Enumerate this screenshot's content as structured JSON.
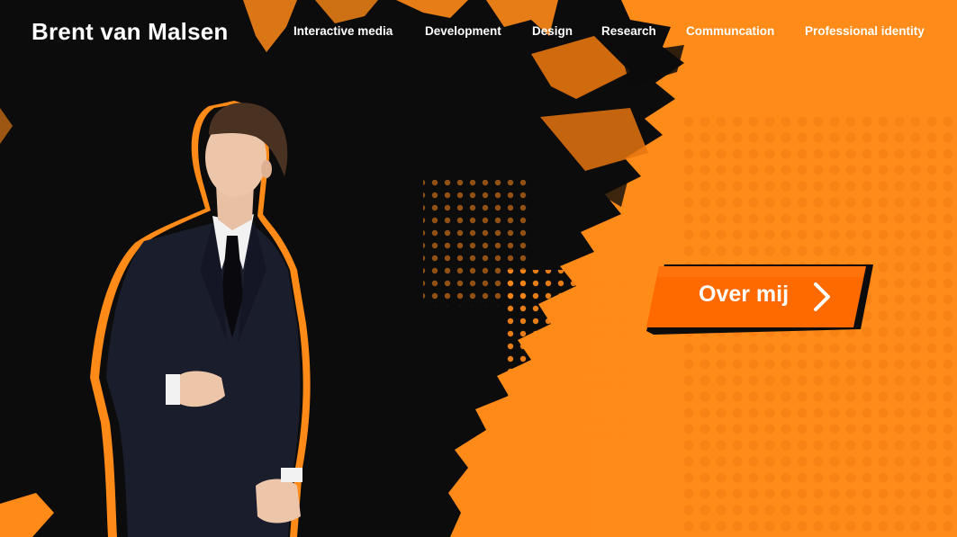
{
  "header": {
    "site_title": "Brent van Malsen",
    "nav": [
      {
        "label": "Interactive media"
      },
      {
        "label": "Development"
      },
      {
        "label": "Design"
      },
      {
        "label": "Research"
      },
      {
        "label": "Communcation"
      },
      {
        "label": "Professional identity"
      }
    ]
  },
  "hero": {
    "cta_label": "Over mij",
    "cta_icon": "chevron-right-icon",
    "portrait_icon": "portrait-figure"
  },
  "colors": {
    "accent": "#ff8a17",
    "accent_dark": "#ff6a00",
    "background": "#0c0c0c",
    "text": "#ffffff"
  }
}
